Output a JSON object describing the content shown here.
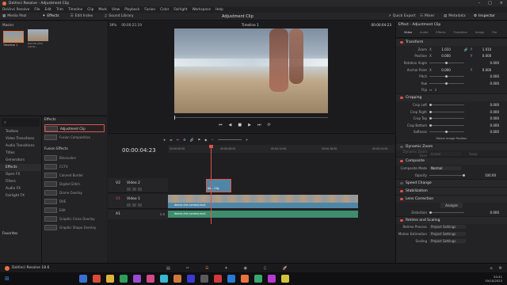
{
  "window": {
    "title": "DaVinci Resolve - Adjustment Clip"
  },
  "menu": [
    "DaVinci Resolve",
    "File",
    "Edit",
    "Trim",
    "Timeline",
    "Clip",
    "Mark",
    "View",
    "Playback",
    "Fusion",
    "Color",
    "Fairlight",
    "Workspace",
    "Help"
  ],
  "toolbar": {
    "media_pool": "Media Pool",
    "effects": "Effects",
    "edit_index": "Edit Index",
    "sound_library": "Sound Library",
    "project_title": "Adjustment Clip",
    "quick_export": "Quick Export",
    "mixer": "Mixer",
    "metadata": "Metadata",
    "inspector": "Inspector"
  },
  "media": {
    "bin": "Master",
    "clips": [
      {
        "label": "Timeline 1"
      },
      {
        "label": "donne-che-corro..."
      }
    ]
  },
  "viewer": {
    "zoom": "39%",
    "timecode_src": "00:00:21:19",
    "timeline_name": "Timeline 1",
    "timecode": "00:00:04:23"
  },
  "effects_lib": {
    "search_placeholder": "Search",
    "tree": [
      {
        "label": "Toolbox",
        "sel": false
      },
      {
        "label": "Video Transitions",
        "sel": false
      },
      {
        "label": "Audio Transitions",
        "sel": false
      },
      {
        "label": "Titles",
        "sel": false
      },
      {
        "label": "Generators",
        "sel": false
      },
      {
        "label": "Effects",
        "sel": true
      },
      {
        "label": "Open FX",
        "sel": false
      },
      {
        "label": "Filters",
        "sel": false
      },
      {
        "label": "Audio FX",
        "sel": false
      },
      {
        "label": "Fairlight FX",
        "sel": false
      }
    ],
    "favorites": "Favorites",
    "effects_header": "Effects",
    "effects": [
      "Adjustment Clip",
      "Fusion Composition"
    ],
    "fusion_header": "Fusion Effects",
    "fusion_effects": [
      "Binoculars",
      "CCTV",
      "Colored Border",
      "Digital Glitch",
      "Drone Overlay",
      "DVE",
      "Edit",
      "Graphic Cross Overlay",
      "Graphic Shape Overlay"
    ]
  },
  "timeline": {
    "timecode": "00:00:04:23",
    "ruler": [
      "00:00:00:00",
      "00:00:06:00",
      "00:00:12:00",
      "00:00:18:00",
      "00:00:24:00"
    ],
    "tracks": [
      {
        "id": "V2",
        "name": "Video 2"
      },
      {
        "id": "V1",
        "name": "Video 1"
      },
      {
        "id": "A1",
        "name": "",
        "vol": "2.0"
      }
    ],
    "adj_clip": "Adj...Clip",
    "video_clip": "donne-che-corrono.mp4",
    "audio_clip": "donne-che-corrono.mp4"
  },
  "inspector": {
    "title": "Effect - Adjustment Clip",
    "tabs": [
      "Video",
      "Audio",
      "Effects",
      "Transition",
      "Image",
      "File"
    ],
    "transform": {
      "header": "Transform",
      "rows": [
        {
          "label": "Zoom",
          "x_label": "X",
          "x": "1.010",
          "y_label": "Y",
          "y": "1.010"
        },
        {
          "label": "Position",
          "x_label": "X",
          "x": "0.000",
          "y_label": "Y",
          "y": "0.000"
        },
        {
          "label": "Rotation Angle",
          "value": "0.000"
        },
        {
          "label": "Anchor Point",
          "x_label": "X",
          "x": "0.000",
          "y_label": "Y",
          "y": "0.000"
        },
        {
          "label": "Pitch",
          "value": "0.000"
        },
        {
          "label": "Yaw",
          "value": "0.000"
        },
        {
          "label": "Flip"
        }
      ]
    },
    "cropping": {
      "header": "Cropping",
      "rows": [
        {
          "label": "Crop Left",
          "value": "0.000"
        },
        {
          "label": "Crop Right",
          "value": "0.000"
        },
        {
          "label": "Crop Top",
          "value": "0.000"
        },
        {
          "label": "Crop Bottom",
          "value": "0.000"
        },
        {
          "label": "Softness",
          "value": "0.000"
        }
      ],
      "retain": "Retain Image Position"
    },
    "dynamic_zoom": {
      "header": "Dynamic Zoom",
      "ease_label": "Dynamic Zoom Ease",
      "ease_value": "Linear",
      "swap": "Swap"
    },
    "composite": {
      "header": "Composite",
      "mode_label": "Composite Mode",
      "mode_value": "Normal",
      "opacity_label": "Opacity",
      "opacity_value": "100.00"
    },
    "speed_change": "Speed Change",
    "stabilization": "Stabilization",
    "lens_correction": {
      "header": "Lens Correction",
      "analyze": "Analyze",
      "distortion_label": "Distortion",
      "distortion_value": "0.000"
    },
    "retime": {
      "header": "Retime and Scaling",
      "rows": [
        {
          "label": "Retime Process",
          "value": "Project Settings"
        },
        {
          "label": "Motion Estimation",
          "value": "Project Settings"
        },
        {
          "label": "Scaling",
          "value": "Project Settings"
        }
      ]
    }
  },
  "bottom": {
    "app_label": "DaVinci Resolve 18.6"
  },
  "taskbar": {
    "time": "20:41",
    "date": "19/10/2023"
  },
  "colors": {
    "accent": "#e9733f",
    "track_video": "#4f86a6",
    "track_audio": "#3e8e6e",
    "playhead": "#e2514b"
  }
}
